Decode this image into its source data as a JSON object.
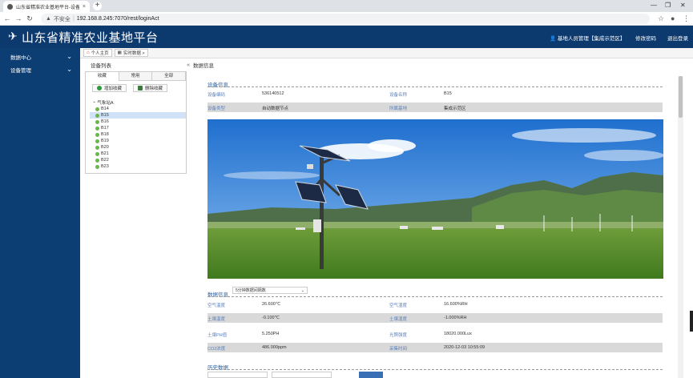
{
  "browser": {
    "tab_title": "山东省精准农业基地平台-设备详",
    "tab_close": "×",
    "new_tab": "+",
    "insecure_label": "不安全",
    "url": "192.168.8.245:7070/rest/loginAct",
    "win_min": "—",
    "win_max": "❐",
    "win_close": "✕"
  },
  "header": {
    "title": "山东省精准农业基地平台",
    "user": "基地人员管理【集成示范区】",
    "change_password": "修改密码",
    "logout": "退出登录"
  },
  "sidebar": {
    "items": [
      {
        "label": "数据中心"
      },
      {
        "label": "设备管理"
      }
    ]
  },
  "breadcrumb": {
    "home": "个人主页",
    "current": "实时数据 >"
  },
  "device_panel": {
    "title": "设备列表",
    "collapse": "«",
    "tabs": [
      "收藏",
      "常用",
      "全部"
    ],
    "add_button": "增加收藏",
    "delete_button": "删除收藏",
    "root": "气象站A",
    "devices": [
      "B14",
      "B15",
      "B16",
      "B17",
      "B18",
      "B19",
      "B20",
      "B21",
      "B22",
      "B23"
    ],
    "selected": "B15"
  },
  "main": {
    "title": "数据信息",
    "device_info": {
      "section": "设备信息",
      "rows": [
        {
          "l1": "设备编码",
          "v1": "536140512",
          "l2": "设备名称",
          "v2": "B15"
        },
        {
          "l1": "设备类型",
          "v1": "自动数据节点",
          "l2": "所属基地",
          "v2": "集成示范区"
        }
      ]
    },
    "data_info": {
      "section": "数据信息",
      "dropdown": "5分钟数据间隔数",
      "rows": [
        {
          "l1": "空气温度",
          "v1": "26.600℃",
          "l2": "空气湿度",
          "v2": "16.600%RH"
        },
        {
          "l1": "土壤温度",
          "v1": "-0.100℃",
          "l2": "土壤湿度",
          "v2": "-1.000%RH"
        },
        {
          "l1": "土壤PH值",
          "v1": "5.250PH",
          "l2": "光照强度",
          "v2": "18020.000Lux"
        },
        {
          "l1": "CO2浓度",
          "v1": "486.000ppm",
          "l2": "采集时间",
          "v2": "2020-12-03 10:55:09"
        }
      ]
    },
    "history": {
      "section": "历史数据"
    }
  }
}
